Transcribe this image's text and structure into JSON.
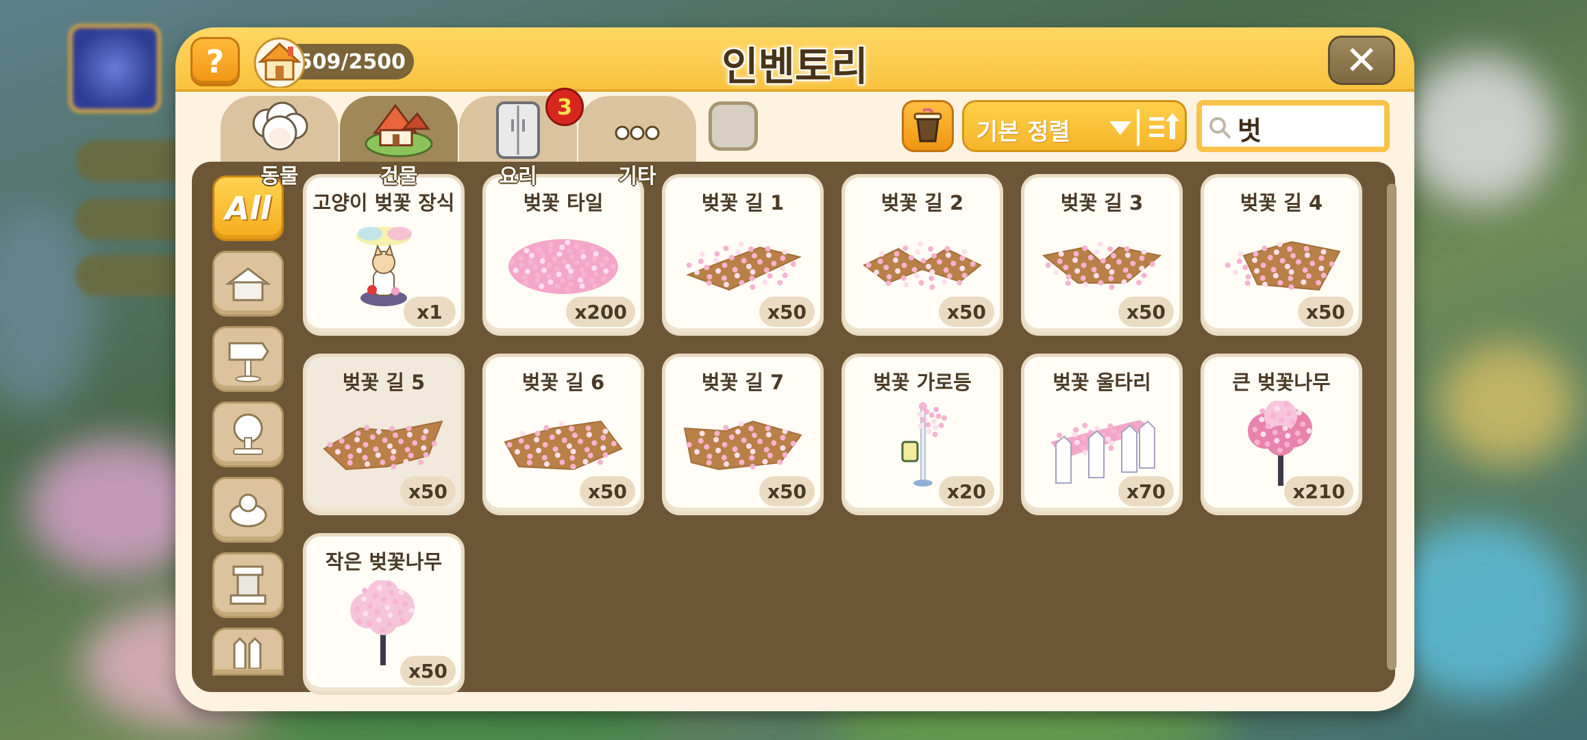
{
  "header": {
    "title": "인벤토리",
    "help_label": "?",
    "capacity": "509/2500",
    "close_label": "✕"
  },
  "tabs": [
    {
      "label": "동물",
      "icon": "sheep-icon",
      "active": false
    },
    {
      "label": "건물",
      "icon": "building-icon",
      "active": true
    },
    {
      "label": "요리",
      "icon": "fridge-icon",
      "active": false
    },
    {
      "label": "기타",
      "icon": "dots-icon",
      "active": false
    }
  ],
  "cooking_badge": "3",
  "sort": {
    "label": "기본 정렬"
  },
  "search": {
    "value": "벗"
  },
  "sidebar": [
    {
      "label": "All",
      "icon": "all-icon",
      "active": true
    },
    {
      "icon": "house-icon"
    },
    {
      "icon": "etc-sign-icon"
    },
    {
      "icon": "tree-statue-icon"
    },
    {
      "icon": "decoration-icon"
    },
    {
      "icon": "pedestal-icon"
    },
    {
      "icon": "fence-icon"
    }
  ],
  "items": [
    {
      "name": "고양이 벚꽃 장식",
      "count": "x1",
      "art": "cat"
    },
    {
      "name": "벚꽃 타일",
      "count": "x200",
      "art": "tile"
    },
    {
      "name": "벚꽃 길 1",
      "count": "x50",
      "art": "path"
    },
    {
      "name": "벚꽃 길 2",
      "count": "x50",
      "art": "path"
    },
    {
      "name": "벚꽃 길 3",
      "count": "x50",
      "art": "path"
    },
    {
      "name": "벚꽃 길 4",
      "count": "x50",
      "art": "path"
    },
    {
      "name": "벚꽃 길 5",
      "count": "x50",
      "art": "path"
    },
    {
      "name": "벚꽃 길 6",
      "count": "x50",
      "art": "path"
    },
    {
      "name": "벚꽃 길 7",
      "count": "x50",
      "art": "path"
    },
    {
      "name": "벚꽃 가로등",
      "count": "x20",
      "art": "lamp"
    },
    {
      "name": "벚꽃 울타리",
      "count": "x70",
      "art": "fence"
    },
    {
      "name": "큰 벚꽃나무",
      "count": "x210",
      "art": "tree"
    },
    {
      "name": "작은 벚꽃나무",
      "count": "x50",
      "art": "tree-small"
    }
  ],
  "colors": {
    "accent": "#f8c33d",
    "panel": "#fdf3e0",
    "content_bg": "#6d5636",
    "blossom": "#f4a6c8",
    "dirt": "#b98047"
  }
}
